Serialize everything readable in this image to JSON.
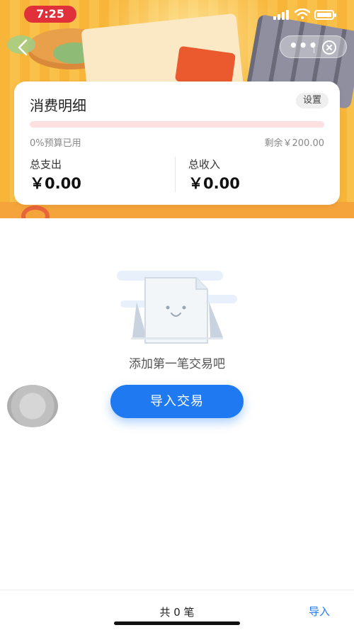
{
  "status_bar": {
    "time": "7:25"
  },
  "card": {
    "title": "消费明细",
    "settings_label": "设置",
    "budget_used_label": "0%预算已用",
    "budget_used_fraction": 0,
    "remaining_label": "剩余￥200.00",
    "total_expense_label": "总支出",
    "total_expense_value": "￥0.00",
    "total_income_label": "总收入",
    "total_income_value": "￥0.00"
  },
  "empty_state": {
    "message": "添加第一笔交易吧",
    "button_label": "导入交易"
  },
  "bottom_bar": {
    "count_label": "共 0 笔",
    "import_link": "导入"
  },
  "colors": {
    "accent": "#1f7af2",
    "budget_bar_track": "#fde0df",
    "header_background": "#f7b63a",
    "time_pill": "#e0313a"
  },
  "icons": [
    "back-arrow-icon",
    "more-icon",
    "close-icon",
    "signal-icon",
    "wifi-icon",
    "battery-icon",
    "document-icon"
  ]
}
